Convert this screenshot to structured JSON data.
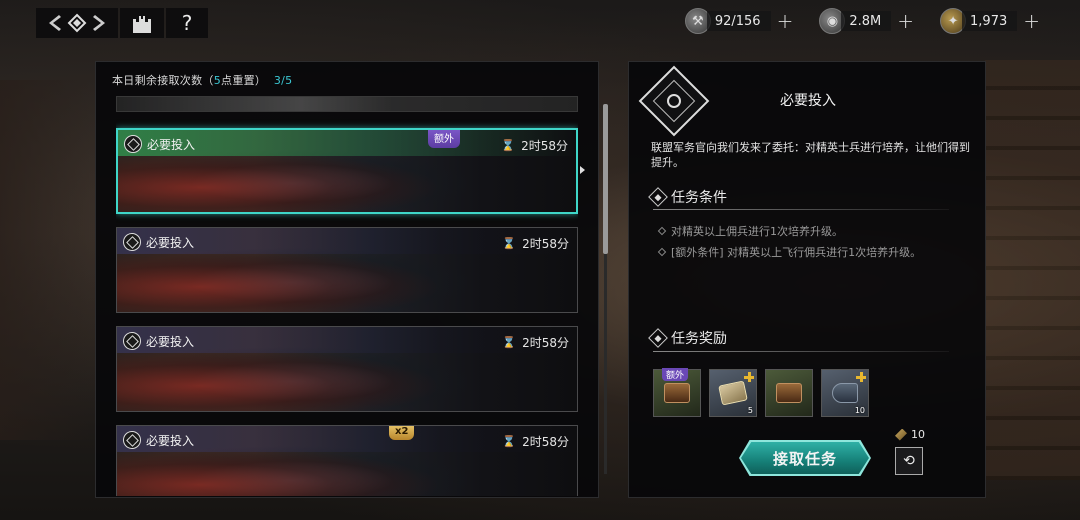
{
  "topbar": {
    "help_label": "?",
    "resources": [
      {
        "icon": "war-hammer-icon",
        "value": "92/156",
        "plus": "+"
      },
      {
        "icon": "silver-coin-icon",
        "value": "2.8M",
        "plus": "+"
      },
      {
        "icon": "gold-feather-icon",
        "value": "1,973",
        "plus": "+"
      }
    ]
  },
  "left": {
    "header_prefix": "本日剩余接取次数（",
    "header_reset_num": "5",
    "header_reset_suffix": "点重置）",
    "header_count": "3/5",
    "cards": [
      {
        "title": "必要投入",
        "time": "2时58分",
        "tag": "额外",
        "tag_color": "purple",
        "selected": true
      },
      {
        "title": "必要投入",
        "time": "2时58分",
        "tag": "",
        "selected": false
      },
      {
        "title": "必要投入",
        "time": "2时58分",
        "tag": "",
        "selected": false
      },
      {
        "title": "必要投入",
        "time": "2时58分",
        "tag": "x2",
        "tag_color": "gold",
        "selected": false
      }
    ]
  },
  "detail": {
    "title": "必要投入",
    "description": "联盟军务官向我们发来了委托：对精英士兵进行培养，让他们得到提升。",
    "conditions_title": "任务条件",
    "conditions": [
      "对精英以上佣兵进行1次培养升级。",
      "[额外条件] 对精英以上飞行佣兵进行1次培养升级。"
    ],
    "rewards_title": "任务奖励",
    "rewards": [
      {
        "icon": "treasure-chest-icon",
        "tag": "额外",
        "count": ""
      },
      {
        "icon": "weapon-scroll-icon",
        "tag": "",
        "count": "5"
      },
      {
        "icon": "treasure-chest-icon",
        "tag": "",
        "count": ""
      },
      {
        "icon": "cannon-icon",
        "tag": "",
        "count": "10"
      }
    ],
    "accept_label": "接取任务",
    "refresh_cost": "10"
  }
}
